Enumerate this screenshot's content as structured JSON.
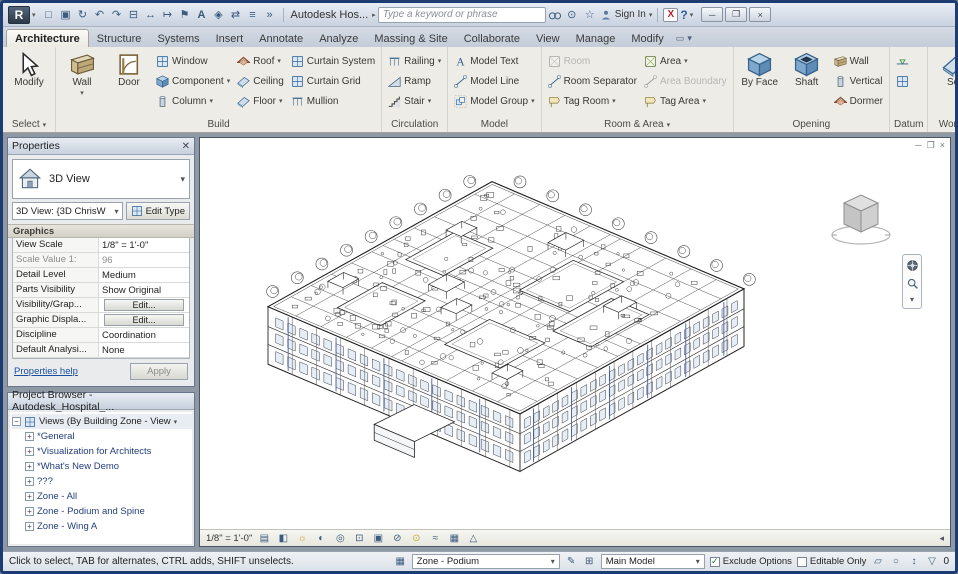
{
  "titlebar": {
    "app_title": "Autodesk Hos...",
    "search_placeholder": "Type a keyword or phrase",
    "sign_in_label": "Sign In"
  },
  "ribbon": {
    "tabs": [
      "Architecture",
      "Structure",
      "Systems",
      "Insert",
      "Annotate",
      "Analyze",
      "Massing & Site",
      "Collaborate",
      "View",
      "Manage",
      "Modify"
    ],
    "select_panel": {
      "label": "Select",
      "modify": "Modify"
    },
    "build_panel": {
      "label": "Build",
      "wall": "Wall",
      "door": "Door",
      "window": "Window",
      "component": "Component",
      "column": "Column",
      "roof": "Roof",
      "ceiling": "Ceiling",
      "floor": "Floor",
      "curtain_system": "Curtain System",
      "curtain_grid": "Curtain Grid",
      "mullion": "Mullion"
    },
    "circulation_panel": {
      "label": "Circulation",
      "railing": "Railing",
      "ramp": "Ramp",
      "stair": "Stair"
    },
    "model_panel": {
      "label": "Model",
      "model_text": "Model Text",
      "model_line": "Model Line",
      "model_group": "Model Group"
    },
    "room_area_panel": {
      "label": "Room & Area",
      "room": "Room",
      "room_separator": "Room Separator",
      "tag_room": "Tag Room",
      "area": "Area",
      "area_boundary": "Area Boundary",
      "tag_area": "Tag Area"
    },
    "opening_panel": {
      "label": "Opening",
      "by_face": "By Face",
      "shaft": "Shaft",
      "wall": "Wall",
      "vertical": "Vertical",
      "dormer": "Dormer"
    },
    "datum_panel": {
      "label": "Datum"
    },
    "work_plane_panel": {
      "label": "Work Plane",
      "set": "Set"
    }
  },
  "properties": {
    "title": "Properties",
    "type_name": "3D View",
    "instance_label": "3D View: {3D  ChrisW",
    "edit_type": "Edit Type",
    "graphics_header": "Graphics",
    "rows": [
      {
        "label": "View Scale",
        "value": "1/8\" = 1'-0\""
      },
      {
        "label": "Scale Value 1:",
        "value": "96"
      },
      {
        "label": "Detail Level",
        "value": "Medium"
      },
      {
        "label": "Parts Visibility",
        "value": "Show Original"
      },
      {
        "label": "Visibility/Grap...",
        "value": "Edit..."
      },
      {
        "label": "Graphic Displa...",
        "value": "Edit..."
      },
      {
        "label": "Discipline",
        "value": "Coordination"
      },
      {
        "label": "Default Analysi...",
        "value": "None"
      }
    ],
    "help_link": "Properties help",
    "apply": "Apply"
  },
  "project_browser": {
    "title": "Project Browser - Autodesk_Hospital_...",
    "root": "Views (By Building Zone - View",
    "items": [
      "*General",
      "*Visualization for Architects",
      "*What's New Demo",
      "???",
      "Zone - All",
      "Zone - Podium and Spine",
      "Zone - Wing A"
    ]
  },
  "canvas": {
    "view_scale": "1/8\" = 1'-0\""
  },
  "status_bar": {
    "hint": "Click to select, TAB for alternates, CTRL adds, SHIFT unselects.",
    "workset": "Zone - Podium",
    "design_option": "Main Model",
    "exclude_options": "Exclude Options",
    "editable_only": "Editable Only",
    "selection_count": "0"
  }
}
